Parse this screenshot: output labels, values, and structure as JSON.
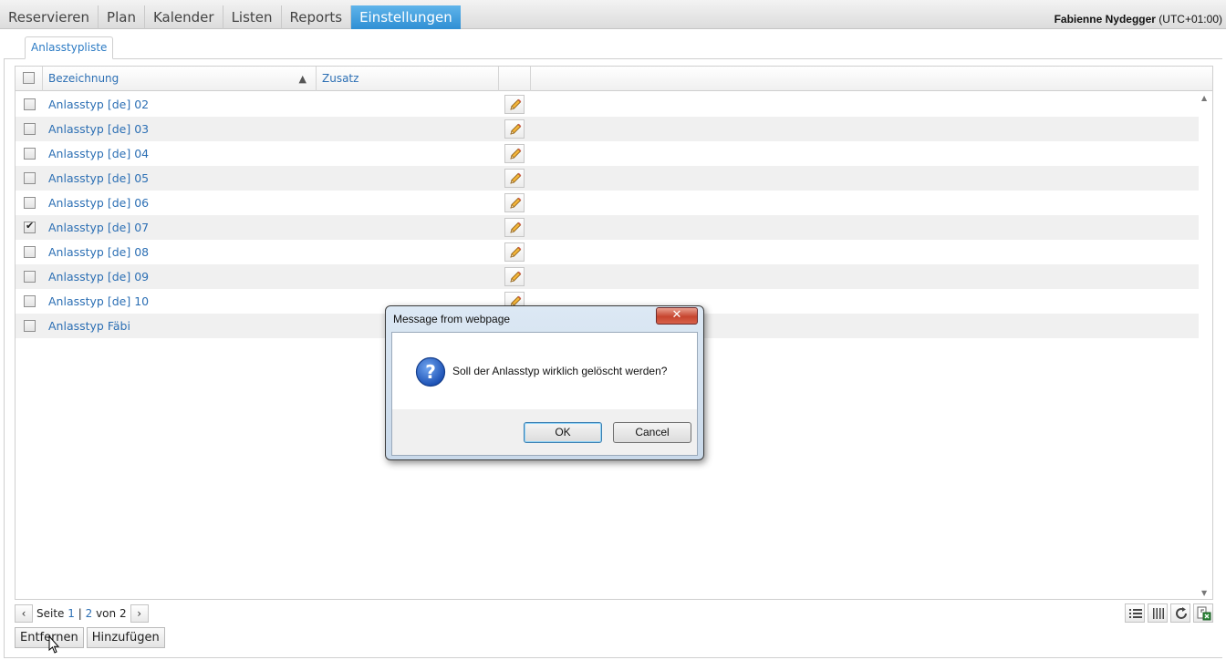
{
  "topnav": {
    "tabs": [
      "Reservieren",
      "Plan",
      "Kalender",
      "Listen",
      "Reports",
      "Einstellungen"
    ],
    "active_tab": "Einstellungen",
    "user_name": "Fabienne Nydegger",
    "user_tz": "(UTC+01:00)"
  },
  "subtab": {
    "label": "Anlasstypliste"
  },
  "grid": {
    "columns": {
      "name": "Bezeichnung",
      "extra": "Zusatz"
    },
    "rows": [
      {
        "label": "Anlasstyp [de] 02",
        "checked": false
      },
      {
        "label": "Anlasstyp [de] 03",
        "checked": false
      },
      {
        "label": "Anlasstyp [de] 04",
        "checked": false
      },
      {
        "label": "Anlasstyp [de] 05",
        "checked": false
      },
      {
        "label": "Anlasstyp [de] 06",
        "checked": false
      },
      {
        "label": "Anlasstyp [de] 07",
        "checked": true
      },
      {
        "label": "Anlasstyp [de] 08",
        "checked": false
      },
      {
        "label": "Anlasstyp [de] 09",
        "checked": false
      },
      {
        "label": "Anlasstyp [de] 10",
        "checked": false
      },
      {
        "label": "Anlasstyp Fäbi",
        "checked": false
      }
    ]
  },
  "pager": {
    "page_label": "Seite",
    "page1": "1",
    "separator": "|",
    "page2": "2",
    "of_label": "von",
    "total": "2"
  },
  "actions": {
    "remove": "Entfernen",
    "add": "Hinzufügen"
  },
  "dialog": {
    "title": "Message from webpage",
    "close": "✕",
    "message": "Soll der Anlasstyp wirklich gelöscht werden?",
    "ok": "OK",
    "cancel": "Cancel"
  }
}
